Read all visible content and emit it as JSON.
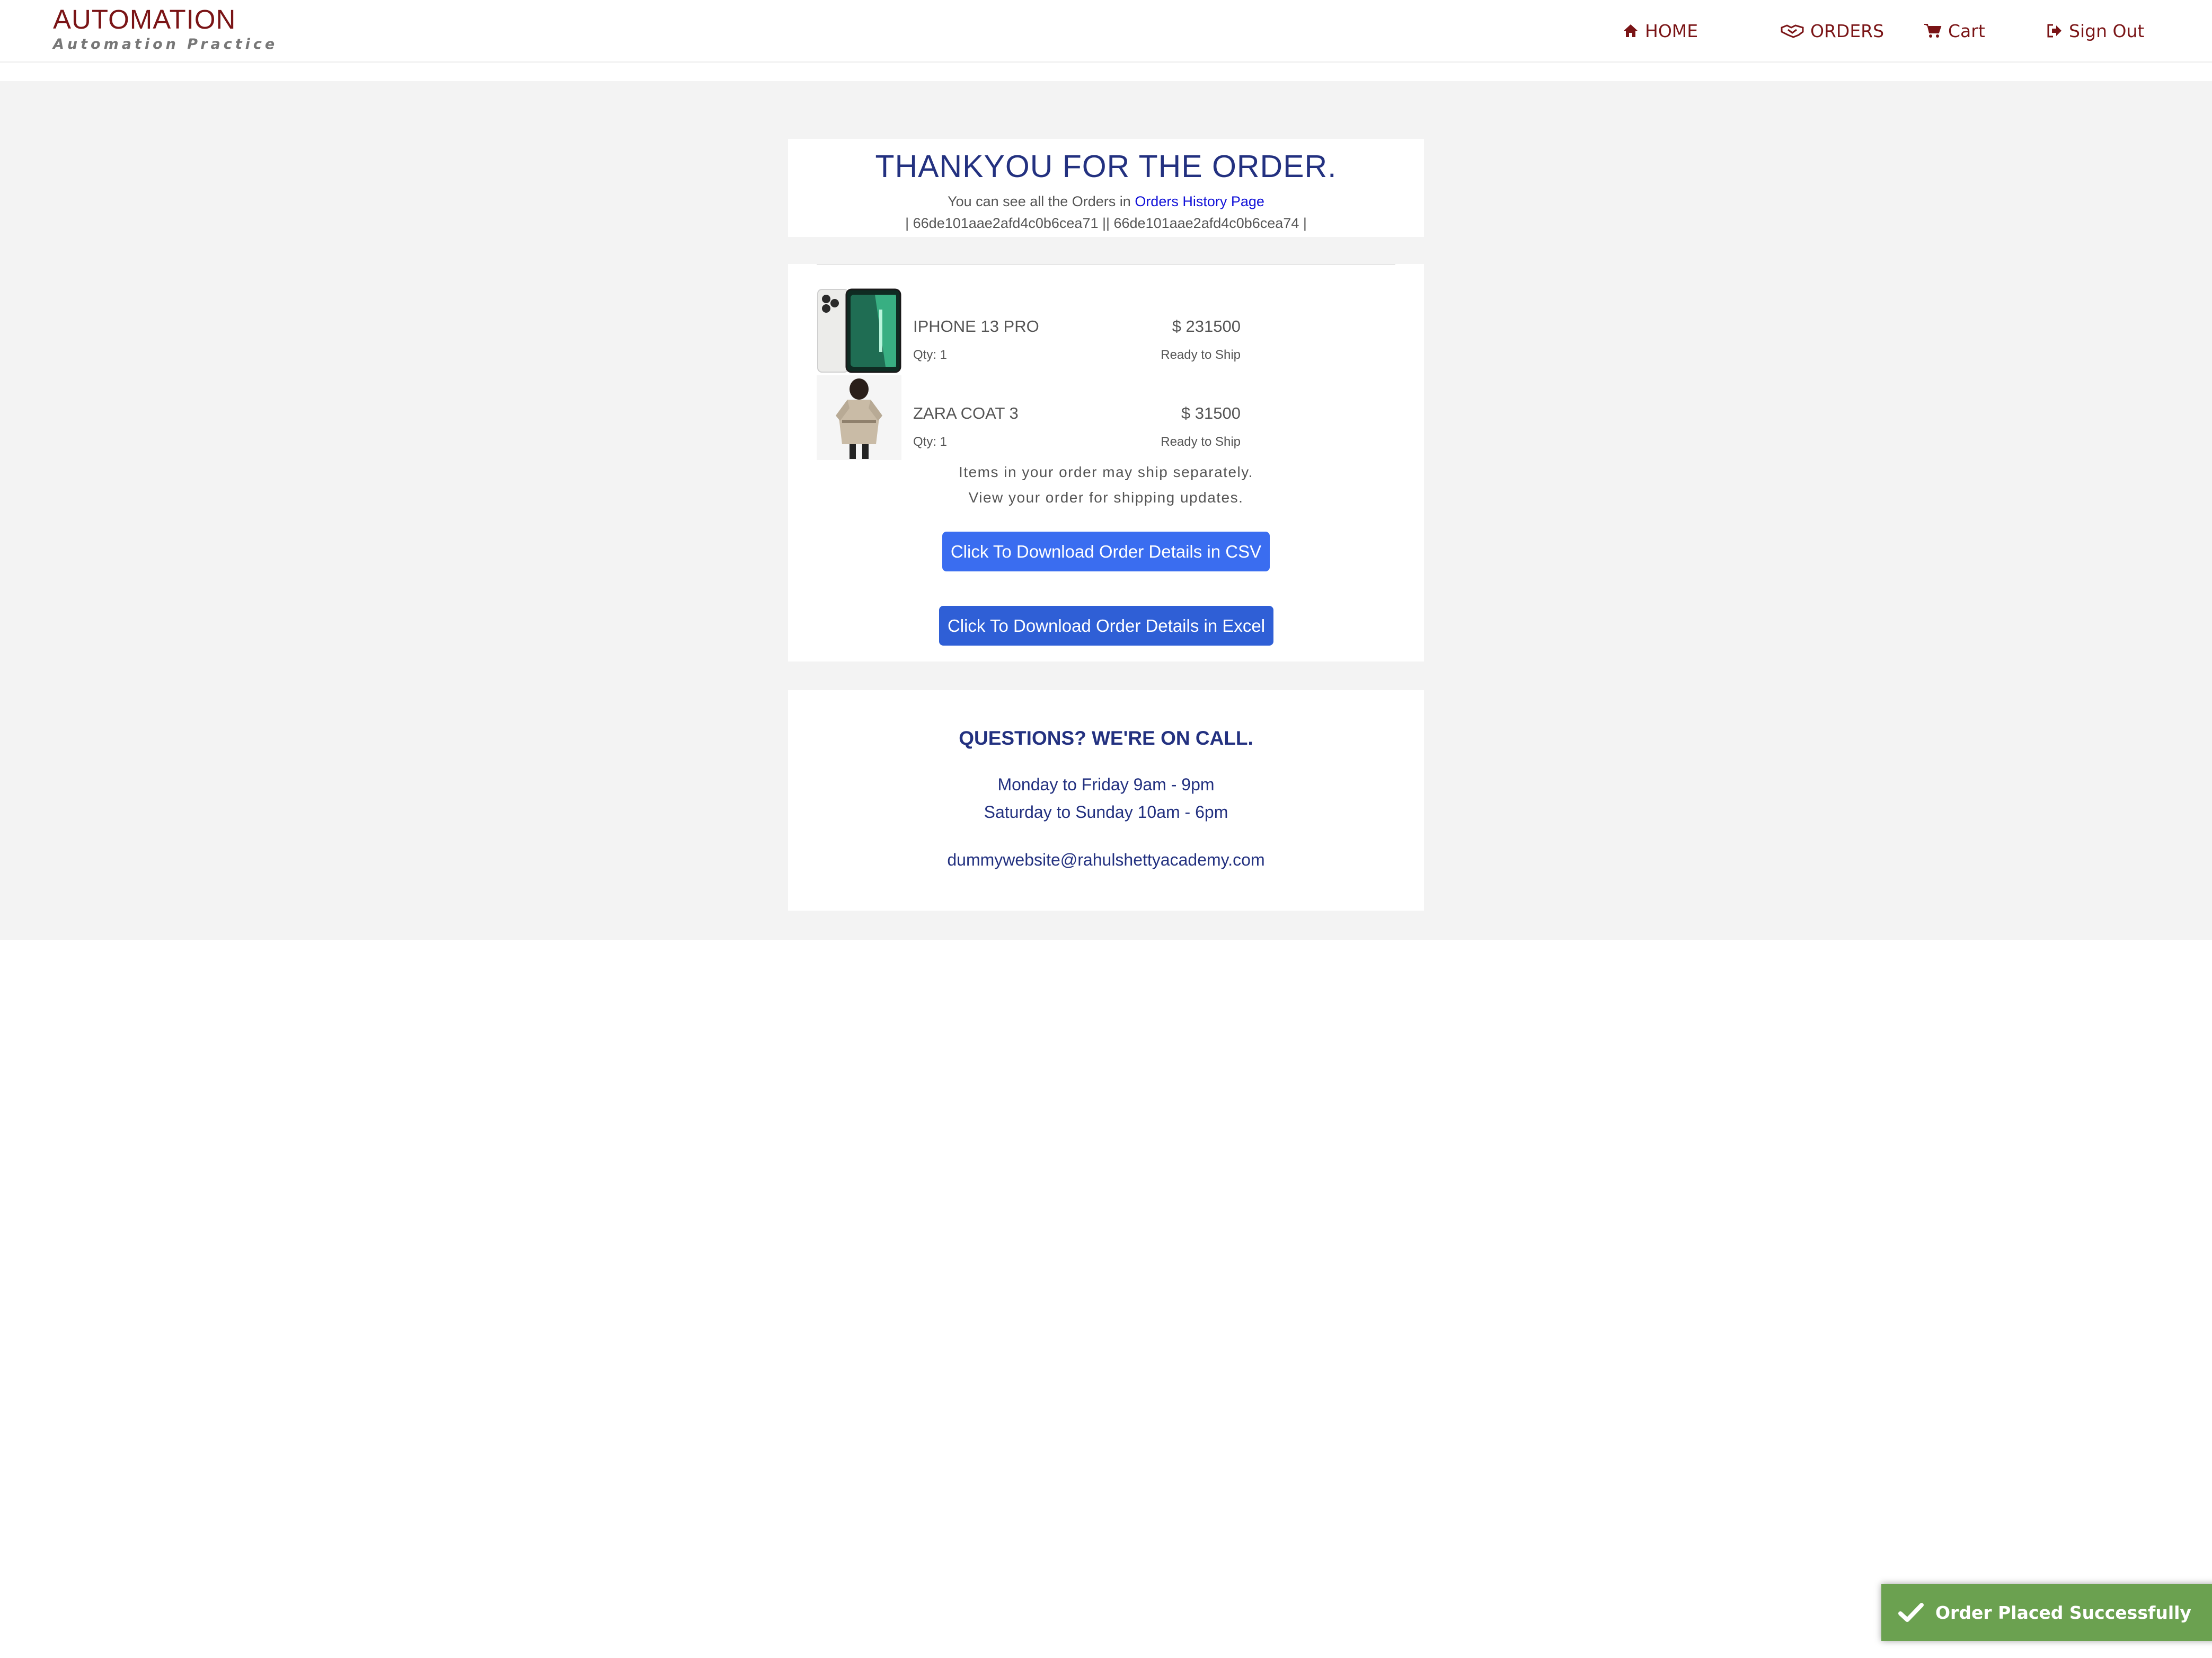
{
  "header": {
    "brand_title": "AUTOMATION",
    "brand_subtitle": "Automation Practice",
    "nav": {
      "home": "HOME",
      "orders": "ORDERS",
      "cart": "Cart",
      "sign_out": "Sign Out"
    },
    "nav_color": "#7a1416"
  },
  "thanks": {
    "title": "THANKYOU FOR THE ORDER.",
    "see_orders_prefix": "You can see all the Orders in",
    "orders_link": "Orders History Page",
    "order_ids": "| 66de101aae2afd4c0b6cea71 || 66de101aae2afd4c0b6cea74 |"
  },
  "items": [
    {
      "name": "IPHONE 13 PRO",
      "price": "$ 231500",
      "qty": "Qty: 1",
      "status": "Ready to Ship",
      "image": "iphone-image"
    },
    {
      "name": "ZARA COAT 3",
      "price": "$ 31500",
      "qty": "Qty: 1",
      "status": "Ready to Ship",
      "image": "coat-image"
    }
  ],
  "shipping_note": {
    "line1": "Items in your order may ship separately.",
    "line2": "View your order for shipping updates."
  },
  "buttons": {
    "csv": "Click To Download Order Details in CSV",
    "excel": "Click To Download Order Details in Excel"
  },
  "contact": {
    "title": "QUESTIONS? WE'RE ON CALL.",
    "weekday_hours": "Monday to Friday 9am - 9pm",
    "weekend_hours": "Saturday to Sunday 10am - 6pm",
    "email": "dummywebsite@rahulshettyacademy.com"
  },
  "toast": {
    "message": "Order Placed Successfully",
    "icon": "checkmark-icon",
    "color": "#6ba150"
  },
  "colors": {
    "accent_blue": "#3a6df0",
    "heading_navy": "#233180",
    "link_blue": "#1212d8",
    "background_grey": "#f3f3f3"
  }
}
